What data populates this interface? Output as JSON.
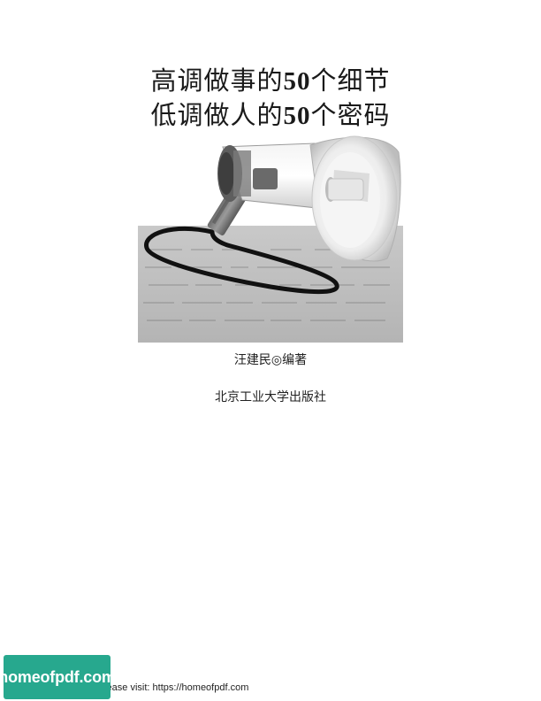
{
  "book": {
    "title_line1_pre": "高调做事的",
    "title_line1_num": "50",
    "title_line1_post": "个细节",
    "title_line2_pre": "低调做人的",
    "title_line2_num": "50",
    "title_line2_post": "个密码",
    "author": "汪建民◎编著",
    "publisher": "北京工业大学出版社"
  },
  "cover_image": {
    "icon": "megaphone-icon",
    "background_text": "gray-texture"
  },
  "footer": {
    "note": "please visit: https://homeofpdf.com",
    "badge_label": "homeofpdf.com",
    "badge_color": "#27a88e"
  }
}
